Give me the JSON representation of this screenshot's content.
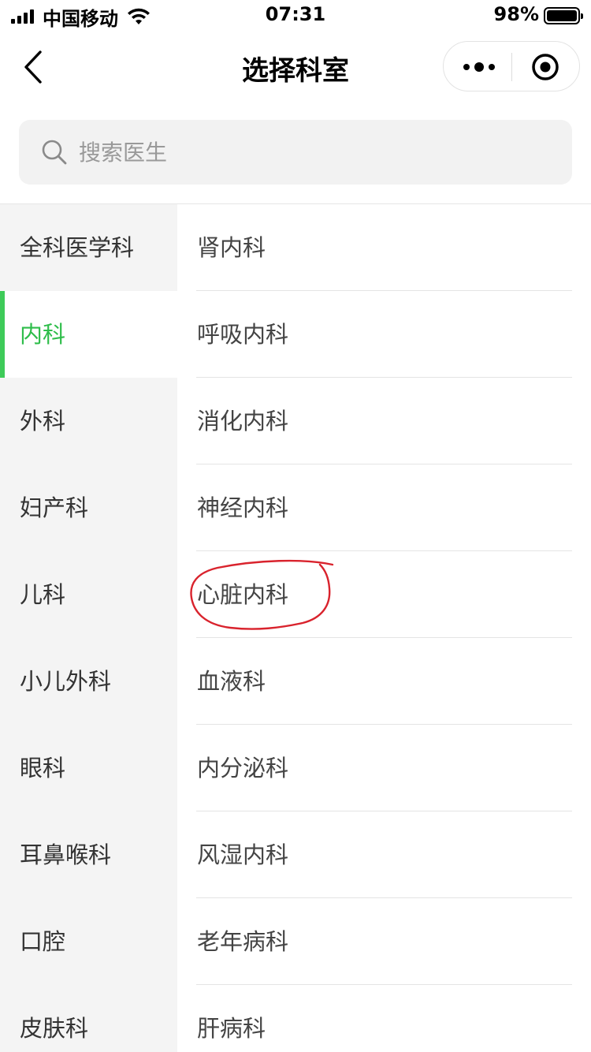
{
  "status_bar": {
    "carrier": "中国移动",
    "time": "07:31",
    "battery": "98%"
  },
  "nav": {
    "title": "选择科室"
  },
  "search": {
    "placeholder": "搜索医生"
  },
  "categories": [
    {
      "label": "全科医学科"
    },
    {
      "label": "内科"
    },
    {
      "label": "外科"
    },
    {
      "label": "妇产科"
    },
    {
      "label": "儿科"
    },
    {
      "label": "小儿外科"
    },
    {
      "label": "眼科"
    },
    {
      "label": "耳鼻喉科"
    },
    {
      "label": "口腔"
    },
    {
      "label": "皮肤科"
    }
  ],
  "active_category": "内科",
  "departments": [
    {
      "label": "肾内科"
    },
    {
      "label": "呼吸内科"
    },
    {
      "label": "消化内科"
    },
    {
      "label": "神经内科"
    },
    {
      "label": "心脏内科"
    },
    {
      "label": "血液科"
    },
    {
      "label": "内分泌科"
    },
    {
      "label": "风湿内科"
    },
    {
      "label": "老年病科"
    },
    {
      "label": "肝病科"
    }
  ],
  "colors": {
    "accent": "#3ecb59",
    "annotation": "#d9232d"
  }
}
